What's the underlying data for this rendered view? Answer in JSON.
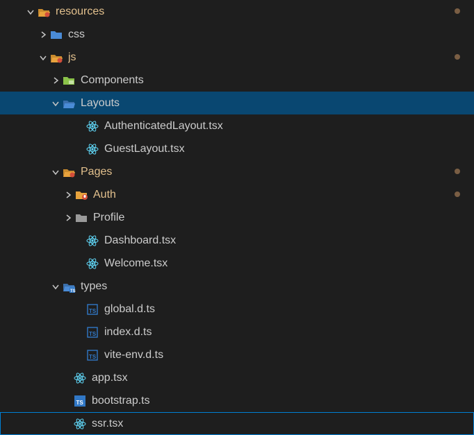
{
  "tree": [
    {
      "depth": 2,
      "expand": "down",
      "icon": "folder-open-modified",
      "label": "resources",
      "modified": true,
      "dot": true,
      "selected": false
    },
    {
      "depth": 3,
      "expand": "right",
      "icon": "folder-blue",
      "label": "css",
      "modified": false,
      "dot": false,
      "selected": false
    },
    {
      "depth": 3,
      "expand": "down",
      "icon": "folder-open-modified",
      "label": "js",
      "modified": true,
      "dot": true,
      "selected": false
    },
    {
      "depth": 4,
      "expand": "right",
      "icon": "folder-green",
      "label": "Components",
      "modified": false,
      "dot": false,
      "selected": false
    },
    {
      "depth": 4,
      "expand": "down",
      "icon": "folder-open-blue",
      "label": "Layouts",
      "modified": false,
      "dot": false,
      "selected": true
    },
    {
      "depth": 5,
      "expand": "none",
      "icon": "react",
      "label": "AuthenticatedLayout.tsx",
      "modified": false,
      "dot": false,
      "selected": false
    },
    {
      "depth": 5,
      "expand": "none",
      "icon": "react",
      "label": "GuestLayout.tsx",
      "modified": false,
      "dot": false,
      "selected": false
    },
    {
      "depth": 4,
      "expand": "down",
      "icon": "folder-open-modified",
      "label": "Pages",
      "modified": true,
      "dot": true,
      "selected": false
    },
    {
      "depth": 5,
      "expand": "right",
      "icon": "folder-orange-badge",
      "label": "Auth",
      "modified": true,
      "dot": true,
      "selected": false
    },
    {
      "depth": 5,
      "expand": "right",
      "icon": "folder-grey",
      "label": "Profile",
      "modified": false,
      "dot": false,
      "selected": false
    },
    {
      "depth": 5,
      "expand": "none",
      "icon": "react",
      "label": "Dashboard.tsx",
      "modified": false,
      "dot": false,
      "selected": false
    },
    {
      "depth": 5,
      "expand": "none",
      "icon": "react",
      "label": "Welcome.tsx",
      "modified": false,
      "dot": false,
      "selected": false
    },
    {
      "depth": 4,
      "expand": "down",
      "icon": "folder-open-blue-ts",
      "label": "types",
      "modified": false,
      "dot": false,
      "selected": false
    },
    {
      "depth": 5,
      "expand": "none",
      "icon": "ts",
      "label": "global.d.ts",
      "modified": false,
      "dot": false,
      "selected": false
    },
    {
      "depth": 5,
      "expand": "none",
      "icon": "ts",
      "label": "index.d.ts",
      "modified": false,
      "dot": false,
      "selected": false
    },
    {
      "depth": 5,
      "expand": "none",
      "icon": "ts",
      "label": "vite-env.d.ts",
      "modified": false,
      "dot": false,
      "selected": false
    },
    {
      "depth": 4,
      "expand": "none",
      "icon": "react",
      "label": "app.tsx",
      "modified": false,
      "dot": false,
      "selected": false
    },
    {
      "depth": 4,
      "expand": "none",
      "icon": "ts-filled",
      "label": "bootstrap.ts",
      "modified": false,
      "dot": false,
      "selected": false
    },
    {
      "depth": 4,
      "expand": "none",
      "icon": "react",
      "label": "ssr.tsx",
      "modified": false,
      "dot": false,
      "selected": false,
      "focused": true
    }
  ]
}
